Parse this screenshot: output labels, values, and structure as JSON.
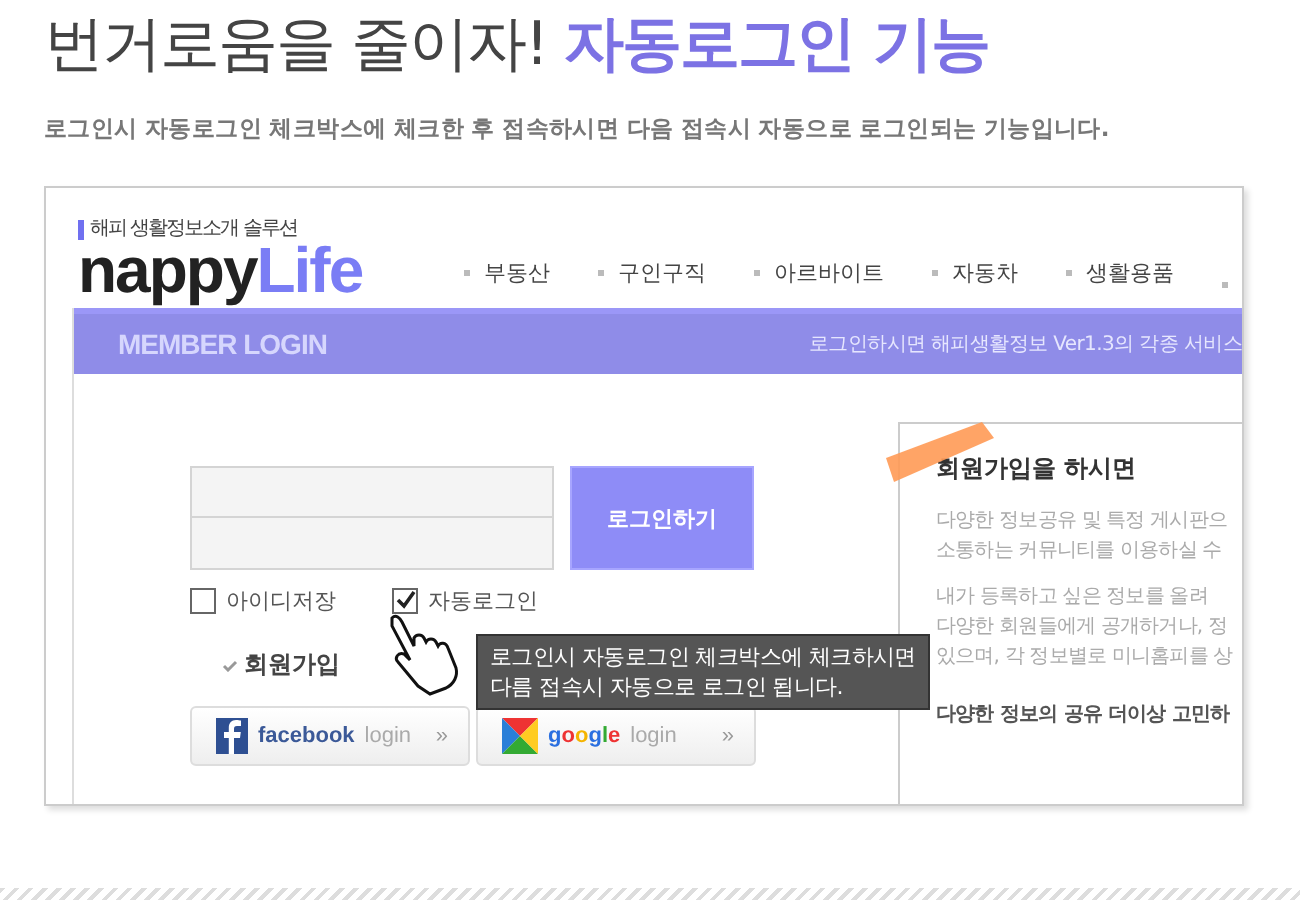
{
  "heading": {
    "plain": "번거로움을 줄이자!",
    "accent": "자동로그인 기능"
  },
  "description": "로그인시 자동로그인 체크박스에 체크한 후 접속하시면 다음 접속시 자동으로 로그인되는 기능입니다.",
  "screenshot": {
    "logo": {
      "tagline": "해피 생활정보소개 솔루션",
      "word1": "nappy",
      "word2": "Life"
    },
    "nav": [
      "부동산",
      "구인구직",
      "아르바이트",
      "자동차",
      "생활용품"
    ],
    "banner": {
      "title": "MEMBER LOGIN",
      "notice": "로그인하시면 해피생활정보 Ver1.3의 각종 서비스"
    },
    "login": {
      "button": "로그인하기",
      "options": [
        {
          "label": "아이디저장",
          "checked": false
        },
        {
          "label": "자동로그인",
          "checked": true
        }
      ],
      "join_link": "회원가입",
      "social": [
        {
          "kind": "facebook",
          "brand": "facebook",
          "action": "login",
          "arrow": "»"
        },
        {
          "kind": "google",
          "brand": "google",
          "action": "login",
          "arrow": "»"
        }
      ]
    },
    "tooltip": [
      "로그인시 자동로그인 체크박스에 체크하시면",
      "다름 접속시 자동으로 로그인 됩니다."
    ],
    "info": {
      "title": "회원가입을 하시면",
      "paragraphs": [
        [
          "다양한 정보공유 및 특정 게시판으",
          "소통하는 커뮤니티를 이용하실 수"
        ],
        [
          "내가 등록하고 싶은 정보를 올려",
          "다양한 회원들에게 공개하거나, 정",
          "있으며, 각 정보별로 미니홈피를 상"
        ]
      ],
      "footer": "다양한 정보의 공유 더이상 고민하"
    }
  }
}
